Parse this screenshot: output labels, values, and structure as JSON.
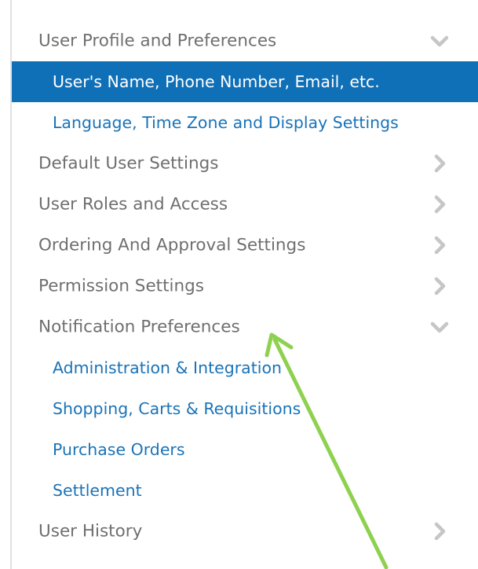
{
  "menu": {
    "sections": [
      {
        "label": "User Profile and Preferences",
        "state": "expanded",
        "chevron_icon": "chevron-down-icon",
        "items": [
          {
            "label": "User's Name, Phone Number, Email, etc.",
            "selected": true
          },
          {
            "label": "Language, Time Zone and Display Settings",
            "selected": false
          }
        ]
      },
      {
        "label": "Default User Settings",
        "state": "collapsed",
        "chevron_icon": "chevron-right-icon"
      },
      {
        "label": "User Roles and Access",
        "state": "collapsed",
        "chevron_icon": "chevron-right-icon"
      },
      {
        "label": "Ordering And Approval Settings",
        "state": "collapsed",
        "chevron_icon": "chevron-right-icon"
      },
      {
        "label": "Permission Settings",
        "state": "collapsed",
        "chevron_icon": "chevron-right-icon"
      },
      {
        "label": "Notification Preferences",
        "state": "expanded",
        "chevron_icon": "chevron-down-icon",
        "items": [
          {
            "label": "Administration & Integration",
            "selected": false
          },
          {
            "label": "Shopping, Carts & Requisitions",
            "selected": false
          },
          {
            "label": "Purchase Orders",
            "selected": false
          },
          {
            "label": "Settlement",
            "selected": false
          }
        ]
      },
      {
        "label": "User History",
        "state": "collapsed",
        "chevron_icon": "chevron-right-icon"
      }
    ]
  },
  "colors": {
    "section_text": "#6f6f6f",
    "link_text": "#1a73b8",
    "selected_bg": "#0f6fb7",
    "selected_text": "#ffffff",
    "chevron": "#c6c6c6",
    "annotation_arrow": "#8ed14f"
  },
  "annotation": {
    "icon": "arrow-annotation-icon"
  }
}
